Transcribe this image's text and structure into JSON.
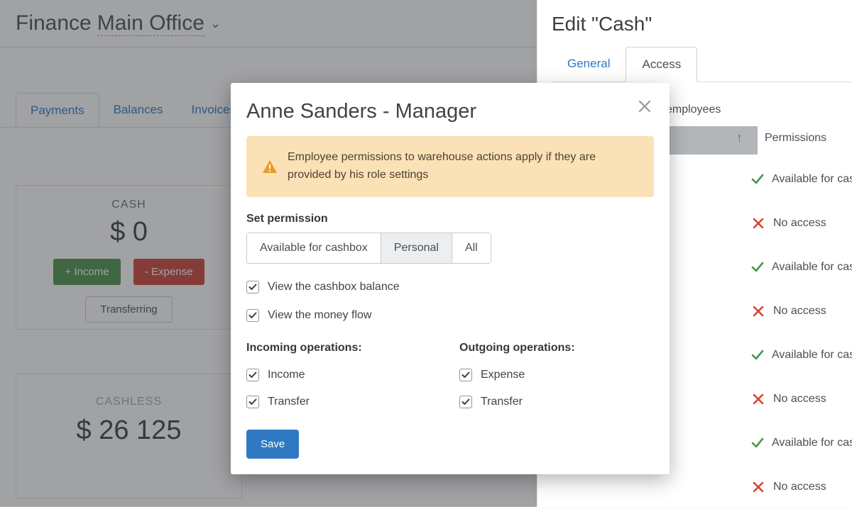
{
  "breadcrumb": {
    "root": "Finance",
    "location": "Main Office"
  },
  "main_tabs": {
    "payments": "Payments",
    "balances": "Balances",
    "invoices": "Invoices"
  },
  "cash_card": {
    "title": "CASH",
    "amount": "$ 0",
    "income_btn": "+ Income",
    "expense_btn": "- Expense",
    "transfer_btn": "Transferring"
  },
  "cashless_card": {
    "title": "CASHLESS",
    "amount": "$ 26 125"
  },
  "side_panel": {
    "title": "Edit \"Cash\"",
    "tab_general": "General",
    "tab_access": "Access",
    "desc_fragment": "ess to the cashbox for employees",
    "col_header": "Permissions",
    "avail": "Available for cas",
    "noaccess": "No access",
    "rows": [
      "avail",
      "no",
      "avail",
      "no",
      "avail",
      "no",
      "avail",
      "no"
    ]
  },
  "modal": {
    "title": "Anne Sanders - Manager",
    "note": "Employee permissions to warehouse actions apply if they are provided by his role settings",
    "set_perm_label": "Set permission",
    "seg": {
      "avail": "Available for cashbox",
      "personal": "Personal",
      "all": "All"
    },
    "chk_balance": "View the cashbox balance",
    "chk_flow": "View the money flow",
    "incoming_title": "Incoming operations:",
    "outgoing_title": "Outgoing operations:",
    "chk_income": "Income",
    "chk_in_transfer": "Transfer",
    "chk_expense": "Expense",
    "chk_out_transfer": "Transfer",
    "save": "Save"
  }
}
